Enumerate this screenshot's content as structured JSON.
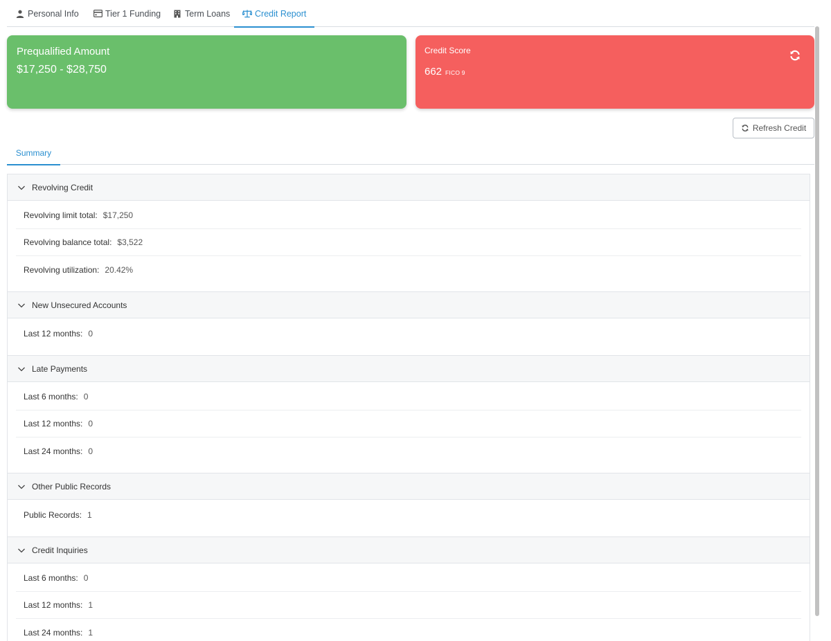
{
  "top_tabs": [
    {
      "label": "Personal Info",
      "icon": "person-icon",
      "active": false
    },
    {
      "label": "Tier 1 Funding",
      "icon": "credit-card-icon",
      "active": false
    },
    {
      "label": "Term Loans",
      "icon": "building-icon",
      "active": false
    },
    {
      "label": "Credit Report",
      "icon": "scales-icon",
      "active": true
    }
  ],
  "prequalified": {
    "title": "Prequalified Amount",
    "amount": "$17,250 - $28,750",
    "color": "#6abf6b"
  },
  "credit_score": {
    "title": "Credit Score",
    "score": "662",
    "score_type": "FICO 9",
    "color": "#f55f5e",
    "icon": "refresh-icon"
  },
  "refresh_button": {
    "label": "Refresh Credit",
    "icon": "refresh-icon"
  },
  "sub_tabs": [
    {
      "label": "Summary",
      "active": true
    }
  ],
  "accent_color": "#2a8fd0",
  "sections": [
    {
      "title": "Revolving Credit",
      "rows": [
        {
          "label": "Revolving limit total:",
          "value": "$17,250"
        },
        {
          "label": "Revolving balance total:",
          "value": "$3,522"
        },
        {
          "label": "Revolving utilization:",
          "value": "20.42%"
        }
      ]
    },
    {
      "title": "New Unsecured Accounts",
      "rows": [
        {
          "label": "Last 12 months:",
          "value": "0"
        }
      ]
    },
    {
      "title": "Late Payments",
      "rows": [
        {
          "label": "Last 6 months:",
          "value": "0"
        },
        {
          "label": "Last 12 months:",
          "value": "0"
        },
        {
          "label": "Last 24 months:",
          "value": "0"
        }
      ]
    },
    {
      "title": "Other Public Records",
      "rows": [
        {
          "label": "Public Records:",
          "value": "1"
        }
      ]
    },
    {
      "title": "Credit Inquiries",
      "rows": [
        {
          "label": "Last 6 months:",
          "value": "0"
        },
        {
          "label": "Last 12 months:",
          "value": "1"
        },
        {
          "label": "Last 24 months:",
          "value": "1"
        }
      ]
    }
  ]
}
